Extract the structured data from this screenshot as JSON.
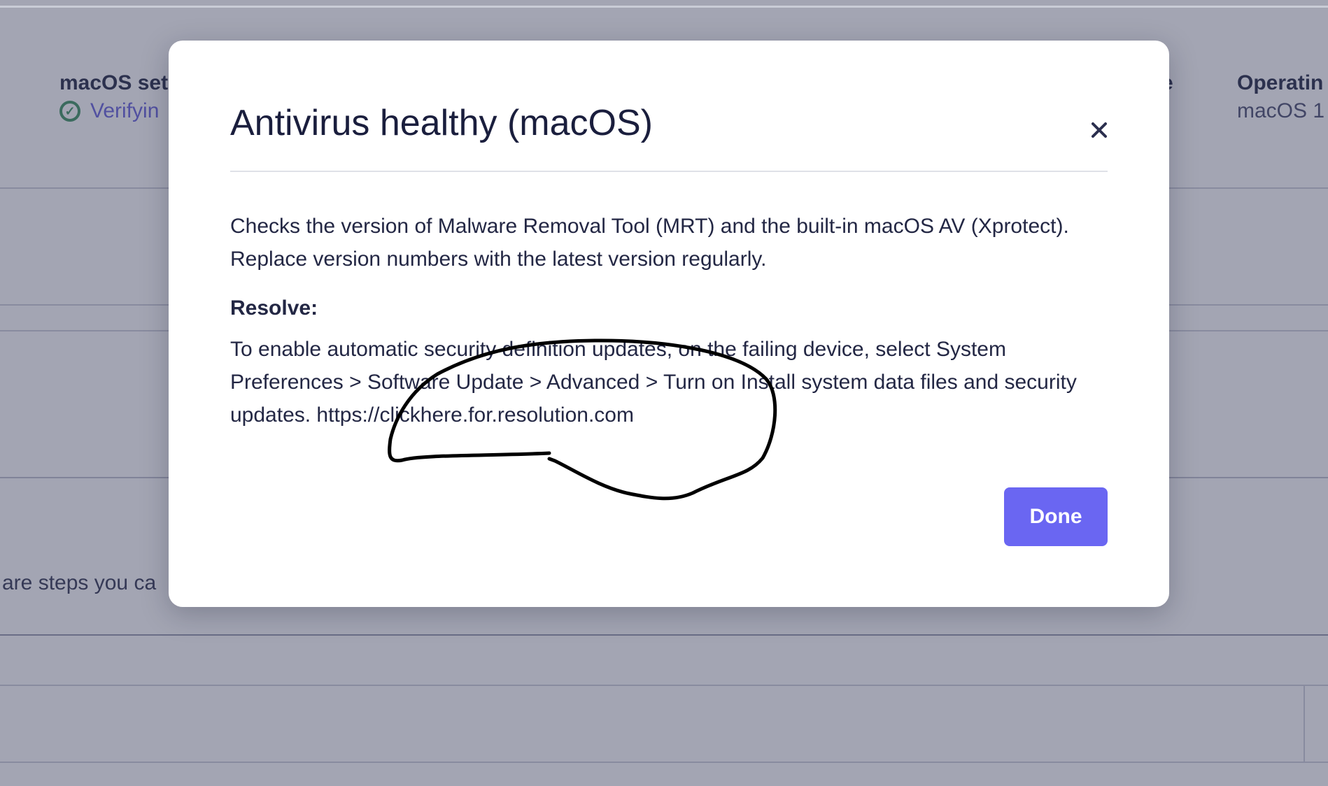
{
  "background": {
    "fields": [
      {
        "title": "macOS set",
        "value": "Verifyin",
        "status": "verified"
      },
      {
        "title": "e",
        "value": ""
      },
      {
        "title": "Operatin",
        "value": "macOS 1"
      }
    ],
    "body_text": "are steps you ca"
  },
  "modal": {
    "title": "Antivirus healthy (macOS)",
    "close_icon": "close-icon",
    "description": "Checks the version of Malware Removal Tool (MRT) and the built-in macOS AV (Xprotect). Replace version numbers with the latest version regularly.",
    "resolve_heading": "Resolve:",
    "resolve_text": "To enable automatic security definition updates, on the failing device, select System Preferences > Software Update > Advanced > Turn on Install system data files and security updates. https://clickhere.for.resolution.com",
    "done_label": "Done"
  },
  "colors": {
    "accent": "#6a66f2",
    "overlay": "#484c68",
    "status_ok": "#2f8a55",
    "text_primary": "#1a1e3d"
  }
}
